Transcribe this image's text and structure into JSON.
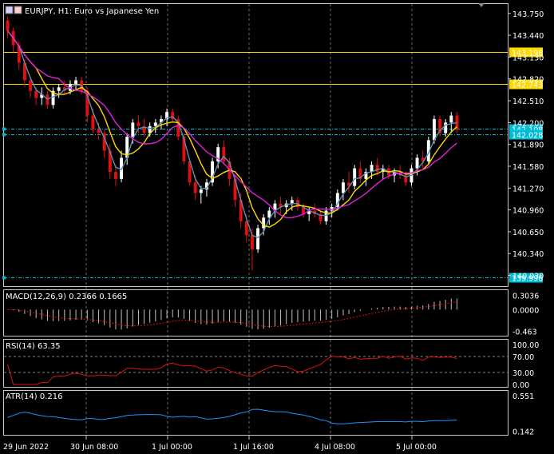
{
  "chart_data": {
    "type": "candlestick",
    "title": "EURJPY, H1:  Euro vs Japanese Yen",
    "symbol": "EURJPY",
    "timeframe": "H1",
    "description": "Euro vs Japanese Yen",
    "background": "#000000",
    "colors": {
      "bull": "#ffffff",
      "bear": "#e01010",
      "ma_fast": "#5b8fb0",
      "ma_mid": "#ffd700",
      "ma_slow": "#e020e0",
      "hline": "#ffd700",
      "level": "#00bcd4",
      "macd_hist": "#c0c0c0",
      "macd_signal": "#e01010",
      "rsi": "#e01010",
      "atr": "#1e90ff",
      "grid": "#ffffff"
    },
    "price_axis": {
      "ticks": [
        "143.750",
        "143.440",
        "143.130",
        "142.820",
        "142.510",
        "142.200",
        "141.890",
        "141.580",
        "141.270",
        "140.960",
        "140.650",
        "140.340",
        "140.030"
      ],
      "ylim": [
        139.9,
        143.85
      ]
    },
    "time_axis": {
      "labels": [
        "29 Jun 2022",
        "30 Jun 08:00",
        "1 Jul 00:00",
        "1 Jul 16:00",
        "4 Jul 08:00",
        "5 Jul 00:00"
      ]
    },
    "horizontal_lines": [
      {
        "price": 143.198,
        "label": "143.198",
        "color": "#ffd700"
      },
      {
        "price": 142.743,
        "label": "142.743",
        "color": "#ffd700"
      },
      {
        "price": 142.108,
        "label": "142.108",
        "color": "#00bcd4"
      },
      {
        "price": 142.028,
        "label": "142.028",
        "color": "#00bcd4"
      },
      {
        "price": 139.996,
        "label": "139.996",
        "color": "#00bcd4"
      }
    ],
    "candles": [
      [
        143.65,
        143.7,
        143.4,
        143.5
      ],
      [
        143.5,
        143.55,
        143.2,
        143.3
      ],
      [
        143.3,
        143.35,
        142.95,
        143.05
      ],
      [
        143.05,
        143.1,
        142.7,
        142.8
      ],
      [
        142.8,
        142.85,
        142.55,
        142.65
      ],
      [
        142.65,
        142.7,
        142.45,
        142.55
      ],
      [
        142.55,
        142.7,
        142.45,
        142.6
      ],
      [
        142.6,
        142.65,
        142.4,
        142.45
      ],
      [
        142.45,
        142.7,
        142.4,
        142.65
      ],
      [
        142.65,
        142.75,
        142.55,
        142.7
      ],
      [
        142.7,
        142.8,
        142.6,
        142.65
      ],
      [
        142.65,
        142.8,
        142.6,
        142.75
      ],
      [
        142.75,
        142.85,
        142.65,
        142.8
      ],
      [
        142.8,
        142.85,
        142.6,
        142.65
      ],
      [
        142.65,
        142.7,
        142.2,
        142.3
      ],
      [
        142.3,
        142.4,
        142.05,
        142.1
      ],
      [
        142.1,
        142.2,
        141.95,
        142.05
      ],
      [
        142.05,
        142.1,
        141.7,
        141.8
      ],
      [
        141.8,
        141.9,
        141.4,
        141.5
      ],
      [
        141.5,
        141.6,
        141.3,
        141.4
      ],
      [
        141.4,
        141.8,
        141.35,
        141.7
      ],
      [
        141.7,
        142.05,
        141.6,
        142.0
      ],
      [
        142.0,
        142.25,
        141.9,
        142.2
      ],
      [
        142.2,
        142.3,
        142.05,
        142.15
      ],
      [
        142.15,
        142.25,
        142.0,
        142.05
      ],
      [
        142.05,
        142.2,
        142.0,
        142.15
      ],
      [
        142.15,
        142.25,
        142.05,
        142.2
      ],
      [
        142.2,
        142.3,
        142.1,
        142.25
      ],
      [
        142.25,
        142.4,
        142.15,
        142.35
      ],
      [
        142.35,
        142.4,
        142.2,
        142.25
      ],
      [
        142.25,
        142.3,
        141.95,
        142.0
      ],
      [
        142.0,
        142.05,
        141.6,
        141.65
      ],
      [
        141.65,
        141.7,
        141.3,
        141.35
      ],
      [
        141.35,
        141.45,
        141.1,
        141.2
      ],
      [
        141.2,
        141.3,
        141.05,
        141.25
      ],
      [
        141.25,
        141.4,
        141.15,
        141.35
      ],
      [
        141.35,
        141.7,
        141.3,
        141.65
      ],
      [
        141.65,
        141.9,
        141.55,
        141.85
      ],
      [
        141.85,
        141.95,
        141.6,
        141.65
      ],
      [
        141.65,
        141.7,
        141.3,
        141.4
      ],
      [
        141.4,
        141.45,
        141.0,
        141.1
      ],
      [
        141.1,
        141.2,
        140.7,
        140.8
      ],
      [
        140.8,
        140.9,
        140.5,
        140.6
      ],
      [
        140.6,
        140.7,
        140.1,
        140.4
      ],
      [
        140.4,
        140.75,
        140.35,
        140.7
      ],
      [
        140.7,
        140.9,
        140.6,
        140.85
      ],
      [
        140.85,
        141.0,
        140.75,
        140.95
      ],
      [
        140.95,
        141.1,
        140.85,
        141.05
      ],
      [
        141.05,
        141.15,
        140.9,
        141.0
      ],
      [
        141.0,
        141.1,
        140.9,
        141.05
      ],
      [
        141.05,
        141.15,
        140.95,
        141.1
      ],
      [
        141.1,
        141.15,
        140.95,
        141.0
      ],
      [
        141.0,
        141.05,
        140.85,
        140.9
      ],
      [
        140.9,
        141.0,
        140.8,
        140.95
      ],
      [
        140.95,
        141.05,
        140.85,
        140.9
      ],
      [
        140.9,
        140.95,
        140.75,
        140.8
      ],
      [
        140.8,
        141.0,
        140.75,
        140.95
      ],
      [
        140.95,
        141.05,
        140.85,
        141.0
      ],
      [
        141.0,
        141.25,
        140.95,
        141.2
      ],
      [
        141.2,
        141.4,
        141.1,
        141.35
      ],
      [
        141.35,
        141.5,
        141.2,
        141.3
      ],
      [
        141.3,
        141.6,
        141.25,
        141.55
      ],
      [
        141.55,
        141.65,
        141.35,
        141.4
      ],
      [
        141.4,
        141.55,
        141.3,
        141.5
      ],
      [
        141.5,
        141.65,
        141.4,
        141.6
      ],
      [
        141.6,
        141.7,
        141.45,
        141.5
      ],
      [
        141.5,
        141.6,
        141.4,
        141.55
      ],
      [
        141.55,
        141.6,
        141.4,
        141.45
      ],
      [
        141.45,
        141.55,
        141.35,
        141.5
      ],
      [
        141.5,
        141.6,
        141.4,
        141.45
      ],
      [
        141.45,
        141.5,
        141.3,
        141.35
      ],
      [
        141.35,
        141.6,
        141.3,
        141.55
      ],
      [
        141.55,
        141.75,
        141.45,
        141.7
      ],
      [
        141.7,
        141.8,
        141.55,
        141.65
      ],
      [
        141.65,
        142.0,
        141.6,
        141.95
      ],
      [
        141.95,
        142.3,
        141.9,
        142.25
      ],
      [
        142.25,
        142.3,
        142.0,
        142.05
      ],
      [
        142.05,
        142.25,
        142.0,
        142.2
      ],
      [
        142.2,
        142.35,
        142.05,
        142.3
      ],
      [
        142.3,
        142.35,
        142.05,
        142.1
      ]
    ],
    "macd": {
      "label": "MACD(12,26,9) 0.2366 0.1665",
      "ticks": [
        "0.3036",
        "0.0000",
        "-0.463"
      ],
      "ylim": [
        -0.52,
        0.36
      ]
    },
    "rsi": {
      "label": "RSI(14) 63.35",
      "ticks": [
        "100.00",
        "70.00",
        "30.00",
        "0.00"
      ],
      "levels": [
        70,
        30
      ]
    },
    "atr": {
      "label": "ATR(14) 0.216",
      "ticks": [
        "0.551",
        "0.142"
      ],
      "ylim": [
        0.12,
        0.58
      ]
    }
  }
}
